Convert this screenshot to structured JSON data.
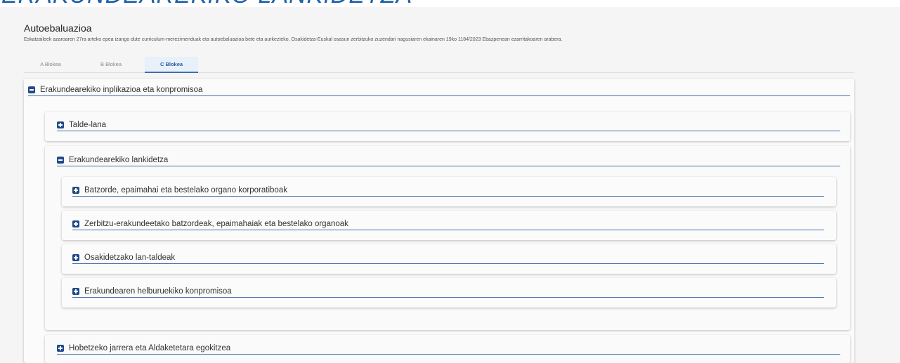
{
  "banner_title": "ERAKUNDEAREKIKO LANKIDETZA",
  "page": {
    "title": "Autoebaluazioa",
    "description": "Eskatzaileek azaroaren 27ra arteko epea izango dute curriculum-merezimenduak eta autoebaluazioa bete eta aurkezteko, Osakidetza-Euskal osasun zerbitzuko zuzendari nagusiaren ekainaren 19ko 1184/2023 Ebazpenean ezarritakoaren arabera."
  },
  "tabs": [
    {
      "label": "A Blokea",
      "active": false
    },
    {
      "label": "B Blokea",
      "active": false
    },
    {
      "label": "C Blokea",
      "active": true
    }
  ],
  "sections": {
    "main": {
      "label": "Erakundearekiko inplikazioa eta konpromisoa",
      "expanded": true
    },
    "talde_lana": {
      "label": "Talde-lana",
      "expanded": false
    },
    "lankidetza": {
      "label": "Erakundearekiko lankidetza",
      "expanded": true,
      "items": [
        {
          "label": "Batzorde, epaimahai eta bestelako organo korporatiboak",
          "expanded": false
        },
        {
          "label": "Zerbitzu-erakundeetako batzordeak, epaimahaiak eta bestelako organoak",
          "expanded": false
        },
        {
          "label": "Osakidetzako lan-taldeak",
          "expanded": false
        },
        {
          "label": "Erakundearen helburuekiko konpromisoa",
          "expanded": false
        }
      ]
    },
    "hobetzeko": {
      "label": "Hobetzeko jarrera eta Aldaketetara egokitzea",
      "expanded": false
    }
  },
  "colors": {
    "banner_text": "#1f5fa6",
    "icon": "#1f4a87",
    "header_underline": "#3f6ea5",
    "active_tab_bg": "#e8f0fa"
  }
}
